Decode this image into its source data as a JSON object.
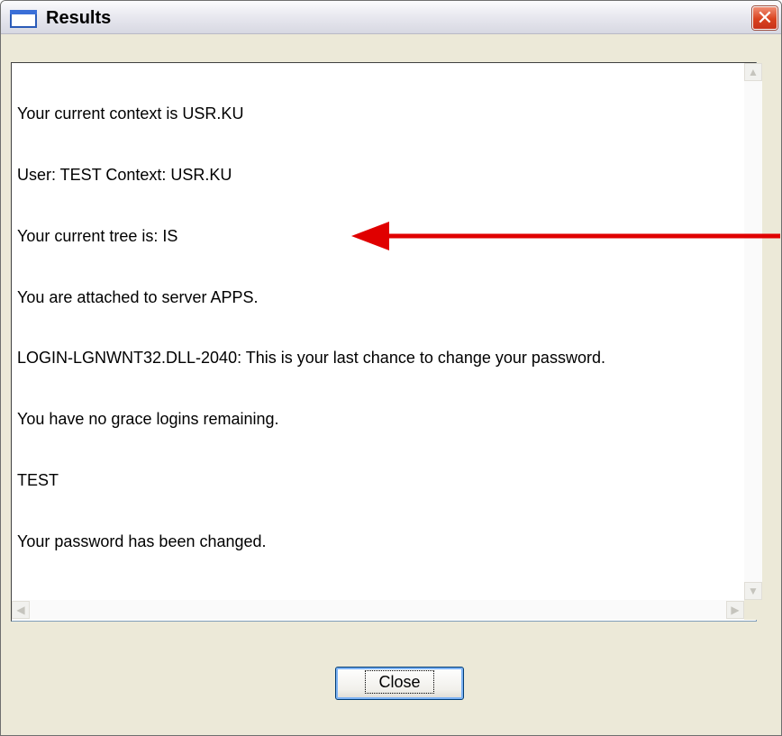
{
  "window": {
    "title": "Results",
    "close_glyph": "✕"
  },
  "output": {
    "lines": [
      "Your current context is USR.KU",
      "User: TEST Context: USR.KU",
      "Your current tree is: IS",
      "You are attached to server APPS.",
      "LOGIN-LGNWNT32.DLL-2040: This is your last chance to change your password.",
      "You have no grace logins remaining.",
      "TEST",
      "Your password has been changed."
    ]
  },
  "scrollbars": {
    "up_glyph": "▲",
    "down_glyph": "▼",
    "left_glyph": "◀",
    "right_glyph": "▶"
  },
  "buttons": {
    "close_label": "Close"
  },
  "annotation": {
    "arrow_color": "#e00000"
  }
}
